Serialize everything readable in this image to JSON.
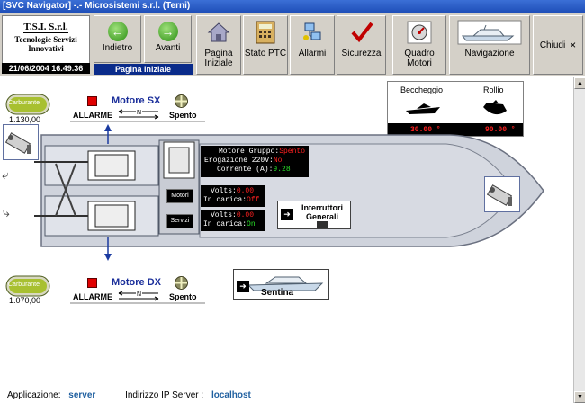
{
  "window": {
    "title": "[SVC Navigator] -.- Microsistemi s.r.l. (Terni)"
  },
  "logo": {
    "line1": "T.S.I. S.r.l.",
    "line2": "Tecnologie Servizi Innovativi"
  },
  "datetime": "21/06/2004 16.49.36",
  "nav": {
    "back": "Indietro",
    "forward": "Avanti",
    "page_label": "Pagina Iniziale"
  },
  "toolbar": {
    "home": "Pagina Iniziale",
    "ptc": "Stato PTC",
    "alarms": "Allarmi",
    "security": "Sicurezza",
    "engines": "Quadro Motori",
    "navigation": "Navigazione",
    "close": "Chiudi"
  },
  "attitude": {
    "pitch_label": "Beccheggio",
    "roll_label": "Rollio",
    "pitch_value": "30.00 °",
    "roll_value": "90.00 °"
  },
  "engine_sx": {
    "name": "Motore SX",
    "fuel_label": "Carburante",
    "fuel_value": "1.130,00",
    "alarm_label": "ALLARME",
    "state": "Spento",
    "gear": "N"
  },
  "engine_dx": {
    "name": "Motore DX",
    "fuel_label": "Carburante",
    "fuel_value": "1.070,00",
    "alarm_label": "ALLARME",
    "state": "Spento",
    "gear": "N"
  },
  "generator": {
    "state_label": "Motore Gruppo:",
    "state_value": "Spento",
    "supply_label": "Erogazione 220V:",
    "supply_value": "No",
    "current_label": "Corrente (A):",
    "current_value": "9.28"
  },
  "batt_motori": {
    "label": "Motori",
    "volts_label": "Volts:",
    "volts_value": "0.00",
    "charge_label": "In carica:",
    "charge_value": "Off"
  },
  "batt_servizi": {
    "label": "Servizi",
    "volts_label": "Volts:",
    "volts_value": "0.00",
    "charge_label": "In carica:",
    "charge_value": "On"
  },
  "switches": {
    "label": "Interruttori Generali"
  },
  "bilge": {
    "label": "Sentina"
  },
  "status": {
    "app_label": "Applicazione:",
    "app_value": "server",
    "ip_label": "Indirizzo IP Server :",
    "ip_value": "localhost"
  },
  "colors": {
    "titlebar": "#1f4fb8",
    "toolbar": "#d4d0c8",
    "alarm_red": "#e00000",
    "engine_blue": "#1a2e9a"
  }
}
